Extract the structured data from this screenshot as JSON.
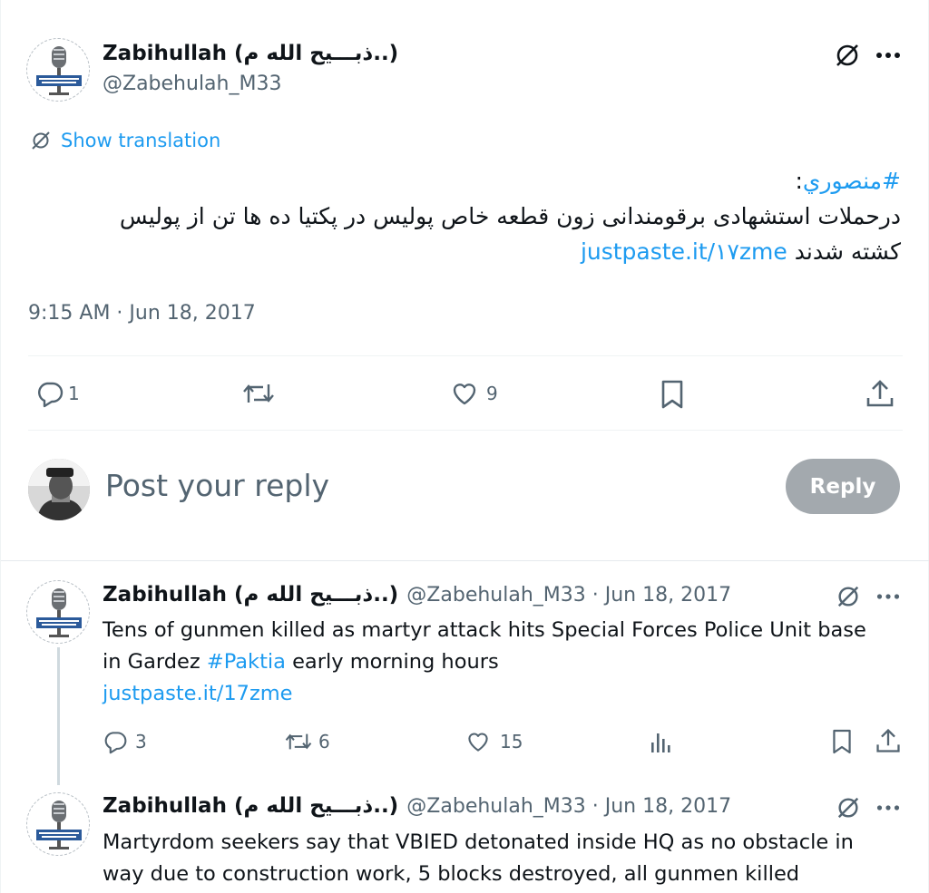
{
  "main": {
    "author": {
      "name": "Zabihullah (ذبـــیح الله م..)",
      "handle": "@Zabehulah_M33"
    },
    "translate_label": "Show translation",
    "hashtag": "#منصوري",
    "hashtag_colon": ":",
    "body_line1": "درحملات استشهادی برقومندانی زون قطعه خاص پولیس در پکتیا ده ها تن از پولیس",
    "body_line2": "کشته شدند",
    "link": "justpaste.it/۱۷zme",
    "timestamp": "9:15 AM · Jun 18, 2017",
    "actions": {
      "replies": "1",
      "likes": "9"
    }
  },
  "composer": {
    "placeholder": "Post your reply",
    "reply_button": "Reply"
  },
  "thread": [
    {
      "name": "Zabihullah (ذبـــیح الله م..)",
      "meta": "@Zabehulah_M33 · Jun 18, 2017",
      "text_line1": "Tens of gunmen killed as martyr attack hits Special Forces Police Unit base",
      "text_line2_before": "in Gardez ",
      "hashtag": "#Paktia",
      "text_line2_after": " early morning hours",
      "link": "justpaste.it/17zme",
      "replies": "3",
      "reposts": "6",
      "likes": "15"
    },
    {
      "name": "Zabihullah (ذبـــیح الله م..)",
      "meta": "@Zabehulah_M33 · Jun 18, 2017",
      "text_line1": "Martyrdom seekers say that VBIED detonated inside HQ as no obstacle in",
      "text_line2": "way due to construction work, 5 blocks destroyed, all gunmen killed"
    }
  ],
  "colors": {
    "link": "#1d9bf0",
    "muted": "#536471",
    "reply_button_bg": "#a3a9ae"
  },
  "icons": [
    "microphone-avatar",
    "translate-icon",
    "more-icon",
    "reply-icon",
    "repost-icon",
    "like-icon",
    "bookmark-icon",
    "share-icon",
    "views-icon"
  ]
}
